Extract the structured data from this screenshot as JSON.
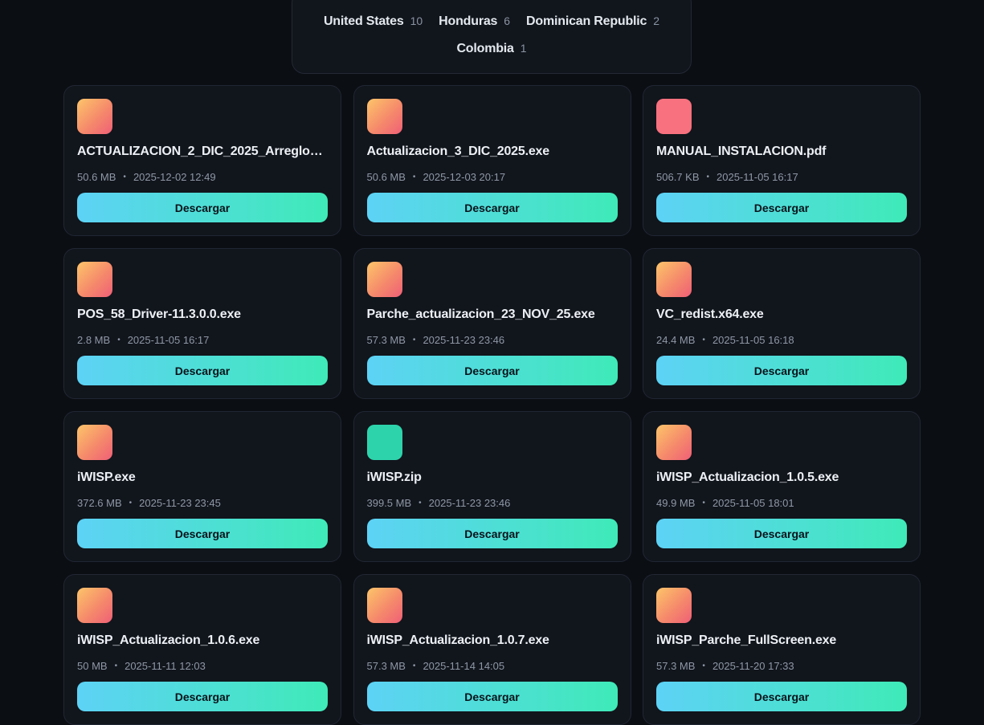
{
  "countries": [
    {
      "name": "United States",
      "count": "10"
    },
    {
      "name": "Honduras",
      "count": "6"
    },
    {
      "name": "Dominican Republic",
      "count": "2"
    },
    {
      "name": "Colombia",
      "count": "1"
    }
  ],
  "files": [
    {
      "name": "ACTUALIZACION_2_DIC_2025_Arreglo_...",
      "size": "50.6 MB",
      "date": "2025-12-02 12:49",
      "icon": "exe-file-icon",
      "button": "Descargar"
    },
    {
      "name": "Actualizacion_3_DIC_2025.exe",
      "size": "50.6 MB",
      "date": "2025-12-03 20:17",
      "icon": "exe-file-icon",
      "button": "Descargar"
    },
    {
      "name": "MANUAL_INSTALACION.pdf",
      "size": "506.7 KB",
      "date": "2025-11-05 16:17",
      "icon": "pdf-file-icon",
      "button": "Descargar"
    },
    {
      "name": "POS_58_Driver-11.3.0.0.exe",
      "size": "2.8 MB",
      "date": "2025-11-05 16:17",
      "icon": "exe-file-icon",
      "button": "Descargar"
    },
    {
      "name": "Parche_actualizacion_23_NOV_25.exe",
      "size": "57.3 MB",
      "date": "2025-11-23 23:46",
      "icon": "exe-file-icon",
      "button": "Descargar"
    },
    {
      "name": "VC_redist.x64.exe",
      "size": "24.4 MB",
      "date": "2025-11-05 16:18",
      "icon": "exe-file-icon",
      "button": "Descargar"
    },
    {
      "name": "iWISP.exe",
      "size": "372.6 MB",
      "date": "2025-11-23 23:45",
      "icon": "exe-file-icon",
      "button": "Descargar"
    },
    {
      "name": "iWISP.zip",
      "size": "399.5 MB",
      "date": "2025-11-23 23:46",
      "icon": "zip-file-icon",
      "button": "Descargar"
    },
    {
      "name": "iWISP_Actualizacion_1.0.5.exe",
      "size": "49.9 MB",
      "date": "2025-11-05 18:01",
      "icon": "exe-file-icon",
      "button": "Descargar"
    },
    {
      "name": "iWISP_Actualizacion_1.0.6.exe",
      "size": "50 MB",
      "date": "2025-11-11 12:03",
      "icon": "exe-file-icon",
      "button": "Descargar"
    },
    {
      "name": "iWISP_Actualizacion_1.0.7.exe",
      "size": "57.3 MB",
      "date": "2025-11-14 14:05",
      "icon": "exe-file-icon",
      "button": "Descargar"
    },
    {
      "name": "iWISP_Parche_FullScreen.exe",
      "size": "57.3 MB",
      "date": "2025-11-20 17:33",
      "icon": "exe-file-icon",
      "button": "Descargar"
    }
  ],
  "meta_separator": "•",
  "colors": {
    "background": "#0b0e13",
    "card": "#11151c",
    "button_start": "#5dd2f5",
    "button_end": "#3feab8",
    "pdf_icon": "#f8717e",
    "zip_icon": "#2dd4ab"
  }
}
